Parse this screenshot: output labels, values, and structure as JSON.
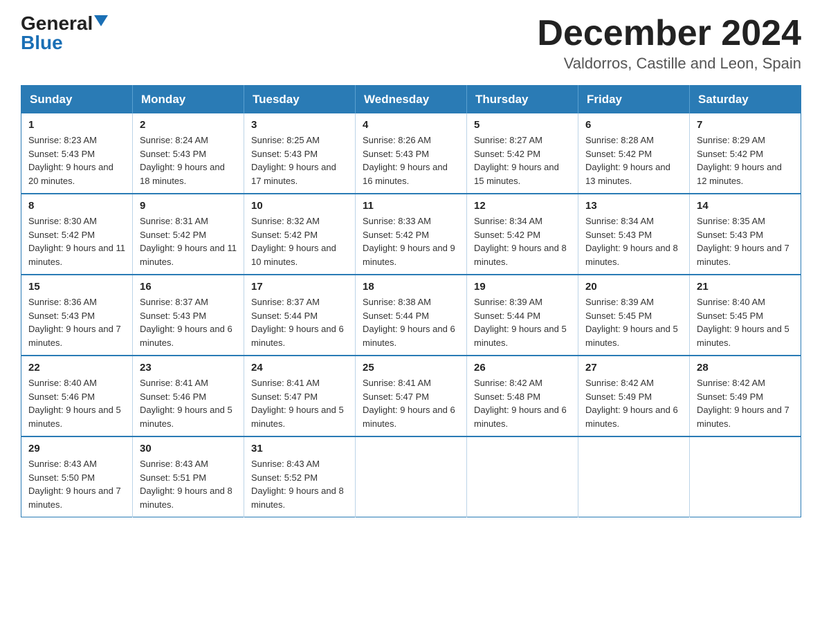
{
  "header": {
    "logo_general": "General",
    "logo_blue": "Blue",
    "title_month": "December 2024",
    "title_location": "Valdorros, Castille and Leon, Spain"
  },
  "calendar": {
    "days_of_week": [
      "Sunday",
      "Monday",
      "Tuesday",
      "Wednesday",
      "Thursday",
      "Friday",
      "Saturday"
    ],
    "weeks": [
      [
        {
          "day": "1",
          "sunrise": "8:23 AM",
          "sunset": "5:43 PM",
          "daylight": "9 hours and 20 minutes."
        },
        {
          "day": "2",
          "sunrise": "8:24 AM",
          "sunset": "5:43 PM",
          "daylight": "9 hours and 18 minutes."
        },
        {
          "day": "3",
          "sunrise": "8:25 AM",
          "sunset": "5:43 PM",
          "daylight": "9 hours and 17 minutes."
        },
        {
          "day": "4",
          "sunrise": "8:26 AM",
          "sunset": "5:43 PM",
          "daylight": "9 hours and 16 minutes."
        },
        {
          "day": "5",
          "sunrise": "8:27 AM",
          "sunset": "5:42 PM",
          "daylight": "9 hours and 15 minutes."
        },
        {
          "day": "6",
          "sunrise": "8:28 AM",
          "sunset": "5:42 PM",
          "daylight": "9 hours and 13 minutes."
        },
        {
          "day": "7",
          "sunrise": "8:29 AM",
          "sunset": "5:42 PM",
          "daylight": "9 hours and 12 minutes."
        }
      ],
      [
        {
          "day": "8",
          "sunrise": "8:30 AM",
          "sunset": "5:42 PM",
          "daylight": "9 hours and 11 minutes."
        },
        {
          "day": "9",
          "sunrise": "8:31 AM",
          "sunset": "5:42 PM",
          "daylight": "9 hours and 11 minutes."
        },
        {
          "day": "10",
          "sunrise": "8:32 AM",
          "sunset": "5:42 PM",
          "daylight": "9 hours and 10 minutes."
        },
        {
          "day": "11",
          "sunrise": "8:33 AM",
          "sunset": "5:42 PM",
          "daylight": "9 hours and 9 minutes."
        },
        {
          "day": "12",
          "sunrise": "8:34 AM",
          "sunset": "5:42 PM",
          "daylight": "9 hours and 8 minutes."
        },
        {
          "day": "13",
          "sunrise": "8:34 AM",
          "sunset": "5:43 PM",
          "daylight": "9 hours and 8 minutes."
        },
        {
          "day": "14",
          "sunrise": "8:35 AM",
          "sunset": "5:43 PM",
          "daylight": "9 hours and 7 minutes."
        }
      ],
      [
        {
          "day": "15",
          "sunrise": "8:36 AM",
          "sunset": "5:43 PM",
          "daylight": "9 hours and 7 minutes."
        },
        {
          "day": "16",
          "sunrise": "8:37 AM",
          "sunset": "5:43 PM",
          "daylight": "9 hours and 6 minutes."
        },
        {
          "day": "17",
          "sunrise": "8:37 AM",
          "sunset": "5:44 PM",
          "daylight": "9 hours and 6 minutes."
        },
        {
          "day": "18",
          "sunrise": "8:38 AM",
          "sunset": "5:44 PM",
          "daylight": "9 hours and 6 minutes."
        },
        {
          "day": "19",
          "sunrise": "8:39 AM",
          "sunset": "5:44 PM",
          "daylight": "9 hours and 5 minutes."
        },
        {
          "day": "20",
          "sunrise": "8:39 AM",
          "sunset": "5:45 PM",
          "daylight": "9 hours and 5 minutes."
        },
        {
          "day": "21",
          "sunrise": "8:40 AM",
          "sunset": "5:45 PM",
          "daylight": "9 hours and 5 minutes."
        }
      ],
      [
        {
          "day": "22",
          "sunrise": "8:40 AM",
          "sunset": "5:46 PM",
          "daylight": "9 hours and 5 minutes."
        },
        {
          "day": "23",
          "sunrise": "8:41 AM",
          "sunset": "5:46 PM",
          "daylight": "9 hours and 5 minutes."
        },
        {
          "day": "24",
          "sunrise": "8:41 AM",
          "sunset": "5:47 PM",
          "daylight": "9 hours and 5 minutes."
        },
        {
          "day": "25",
          "sunrise": "8:41 AM",
          "sunset": "5:47 PM",
          "daylight": "9 hours and 6 minutes."
        },
        {
          "day": "26",
          "sunrise": "8:42 AM",
          "sunset": "5:48 PM",
          "daylight": "9 hours and 6 minutes."
        },
        {
          "day": "27",
          "sunrise": "8:42 AM",
          "sunset": "5:49 PM",
          "daylight": "9 hours and 6 minutes."
        },
        {
          "day": "28",
          "sunrise": "8:42 AM",
          "sunset": "5:49 PM",
          "daylight": "9 hours and 7 minutes."
        }
      ],
      [
        {
          "day": "29",
          "sunrise": "8:43 AM",
          "sunset": "5:50 PM",
          "daylight": "9 hours and 7 minutes."
        },
        {
          "day": "30",
          "sunrise": "8:43 AM",
          "sunset": "5:51 PM",
          "daylight": "9 hours and 8 minutes."
        },
        {
          "day": "31",
          "sunrise": "8:43 AM",
          "sunset": "5:52 PM",
          "daylight": "9 hours and 8 minutes."
        },
        null,
        null,
        null,
        null
      ]
    ]
  }
}
